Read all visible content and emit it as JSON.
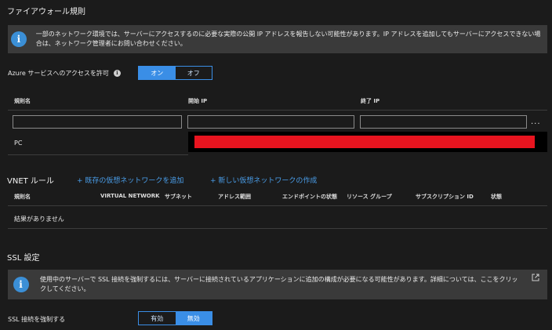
{
  "firewall": {
    "title": "ファイアウォール規則",
    "info_text": "一部のネットワーク環境では、サーバーにアクセスするのに必要な実際の公開 IP アドレスを報告しない可能性があります。IP アドレスを追加してもサーバーにアクセスできない場合は、ネットワーク管理者にお問い合わせください。",
    "azure_access_label": "Azure サービスへのアクセスを許可",
    "toggle_on": "オン",
    "toggle_off": "オフ",
    "columns": [
      "規則名",
      "開始 IP",
      "終了 IP"
    ],
    "row_name": "PC",
    "more": "..."
  },
  "vnet": {
    "title": "VNET ルール",
    "add_existing": "+ 既存の仮想ネットワークを追加",
    "create_new": "+ 新しい仮想ネットワークの作成",
    "columns": [
      "規則名",
      "VIRTUAL NETWORK",
      "サブネット",
      "アドレス範囲",
      "エンドポイントの状態",
      "リソース グループ",
      "サブスクリプション ID",
      "状態"
    ],
    "empty": "結果がありません"
  },
  "ssl": {
    "title": "SSL 設定",
    "info_text": "使用中のサーバーで SSL 接続を強制するには、サーバーに接続されているアプリケーションに追加の構成が必要になる可能性があります。詳細については、ここをクリックしてください。",
    "enforce_label": "SSL 接続を強制する",
    "toggle_enabled": "有効",
    "toggle_disabled": "無効"
  },
  "colors": {
    "accent": "#3a8ee6",
    "redacted": "#e8141f"
  }
}
